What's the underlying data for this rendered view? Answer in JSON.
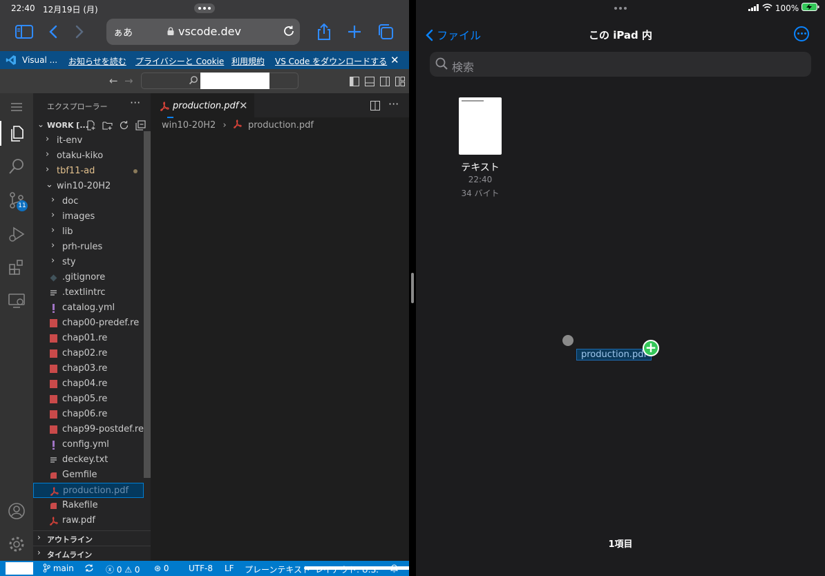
{
  "ios": {
    "time": "22:40",
    "date": "12月19日 (月)",
    "battery": "100%"
  },
  "safari": {
    "aa_label": "ぁあ",
    "url": "vscode.dev"
  },
  "banner": {
    "app": "Visual ...",
    "links": [
      "お知らせを読む",
      "プライバシーと Cookie",
      "利用規約",
      "VS Code をダウンロードする"
    ]
  },
  "sidebar": {
    "header": "エクスプローラー",
    "workspace": "WORK [...",
    "items": [
      {
        "label": "it-env",
        "type": "folder",
        "level": 0,
        "open": false
      },
      {
        "label": "otaku-kiko",
        "type": "folder",
        "level": 0,
        "open": false
      },
      {
        "label": "tbf11-ad",
        "type": "folder",
        "level": 0,
        "open": false,
        "modified": true
      },
      {
        "label": "win10-20H2",
        "type": "folder",
        "level": 0,
        "open": true
      },
      {
        "label": "doc",
        "type": "folder",
        "level": 1,
        "open": false
      },
      {
        "label": "images",
        "type": "folder",
        "level": 1,
        "open": false
      },
      {
        "label": "lib",
        "type": "folder",
        "level": 1,
        "open": false
      },
      {
        "label": "prh-rules",
        "type": "folder",
        "level": 1,
        "open": false
      },
      {
        "label": "sty",
        "type": "folder",
        "level": 1,
        "open": false
      },
      {
        "label": ".gitignore",
        "type": "git",
        "level": 1
      },
      {
        "label": ".textlintrc",
        "type": "lines",
        "level": 1
      },
      {
        "label": "catalog.yml",
        "type": "yml",
        "level": 1
      },
      {
        "label": "chap00-predef.re",
        "type": "re",
        "level": 1
      },
      {
        "label": "chap01.re",
        "type": "re",
        "level": 1
      },
      {
        "label": "chap02.re",
        "type": "re",
        "level": 1
      },
      {
        "label": "chap03.re",
        "type": "re",
        "level": 1
      },
      {
        "label": "chap04.re",
        "type": "re",
        "level": 1
      },
      {
        "label": "chap05.re",
        "type": "re",
        "level": 1
      },
      {
        "label": "chap06.re",
        "type": "re",
        "level": 1
      },
      {
        "label": "chap99-postdef.re",
        "type": "re",
        "level": 1
      },
      {
        "label": "config.yml",
        "type": "yml",
        "level": 1
      },
      {
        "label": "deckey.txt",
        "type": "lines",
        "level": 1
      },
      {
        "label": "Gemfile",
        "type": "ruby",
        "level": 1
      },
      {
        "label": "production.pdf",
        "type": "pdf",
        "level": 1,
        "selected": true
      },
      {
        "label": "Rakefile",
        "type": "ruby",
        "level": 1
      },
      {
        "label": "raw.pdf",
        "type": "pdf",
        "level": 1
      }
    ],
    "outline": "アウトライン",
    "timeline": "タイムライン"
  },
  "activity": {
    "scm_badge": "11"
  },
  "editor": {
    "tab": "production.pdf",
    "breadcrumb_folder": "win10-20H2",
    "breadcrumb_file": "production.pdf"
  },
  "statusbar": {
    "branch": "main",
    "errors": "0",
    "warnings": "0",
    "ports": "0",
    "encoding": "UTF-8",
    "eol": "LF",
    "language": "プレーンテキスト",
    "extra": "レイアウト: U.S."
  },
  "files": {
    "back_label": "ファイル",
    "title": "この iPad 内",
    "search_placeholder": "検索",
    "file": {
      "name": "テキスト",
      "time": "22:40",
      "size": "34 バイト"
    },
    "drag_label": "production.pdf",
    "count": "1項目"
  },
  "colors": {
    "accent": "#0a84ff",
    "vscode_blue": "#007acc",
    "re_icon": "#c94a4a",
    "yml_icon": "#a074c4",
    "pdf_icon": "#d9423a"
  }
}
